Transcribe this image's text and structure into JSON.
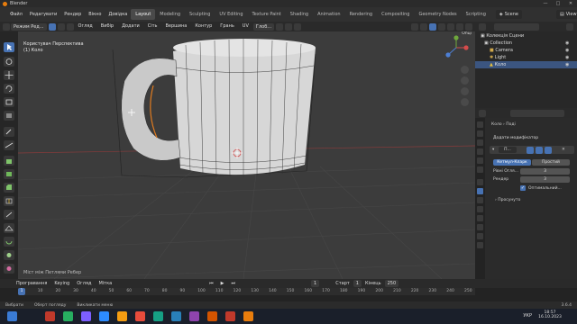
{
  "window": {
    "title": "Blender",
    "controls": [
      "—",
      "□",
      "✕"
    ]
  },
  "menu": {
    "items": [
      "Файл",
      "Редагувати",
      "Рендер",
      "Вікно",
      "Довідка"
    ],
    "workspaces": [
      "Layout",
      "Modeling",
      "Sculpting",
      "UV Editing",
      "Texture Paint",
      "Shading",
      "Animation",
      "Rendering",
      "Compositing",
      "Geometry Nodes",
      "Scripting"
    ],
    "active_workspace": "Layout",
    "scene": "Scene",
    "view_layer": "ViewLayer"
  },
  "viewport_header": {
    "mode": "Режим Ред...",
    "menus": [
      "Огляд",
      "Вибір",
      "Додати",
      "Сіть",
      "Вершина",
      "Контур",
      "Грань",
      "UV"
    ],
    "transform": "Глоб...",
    "overlays": "Опці"
  },
  "viewport": {
    "view_name": "Користувач Перспектива",
    "object_name": "(1) Коло",
    "status_hint": "Міст між Петлями Ребер"
  },
  "outliner": {
    "rows": [
      {
        "label": "Колекція Сцени"
      },
      {
        "label": "Collection"
      },
      {
        "label": "Camera"
      },
      {
        "label": "Light"
      },
      {
        "label": "Коло"
      }
    ]
  },
  "properties": {
    "breadcrumb_object": "Коло",
    "breadcrumb_sub": "Поді",
    "add_modifier": "Додати модифікатор",
    "modifier_name": "П...",
    "tab_catmull": "Кетмул-Кларк",
    "tab_simple": "Простий",
    "levels_viewport_label": "Рівні Огля...",
    "levels_viewport_value": "3",
    "render_label": "Рендер",
    "render_value": "3",
    "optimal_label": "Оптимальний...",
    "advanced_label": "Просунуто"
  },
  "timeline": {
    "menus": [
      "Програвання",
      "Keying",
      "Огляд",
      "Мітка"
    ],
    "current_frame": "1",
    "start_label": "Старт",
    "start_value": "1",
    "end_label": "Кінець",
    "end_value": "250",
    "ticks": [
      "1",
      "10",
      "20",
      "30",
      "40",
      "50",
      "60",
      "70",
      "80",
      "90",
      "100",
      "110",
      "120",
      "130",
      "140",
      "150",
      "160",
      "170",
      "180",
      "190",
      "200",
      "210",
      "220",
      "230",
      "240",
      "250"
    ]
  },
  "statusbar": {
    "select": "Вибрати",
    "rotate": "Оберт погляду",
    "menu": "Викликати меню",
    "version": "3.6.4"
  },
  "taskbar": {
    "language": "УКР",
    "time": "18:57",
    "date": "16.10.2023"
  }
}
